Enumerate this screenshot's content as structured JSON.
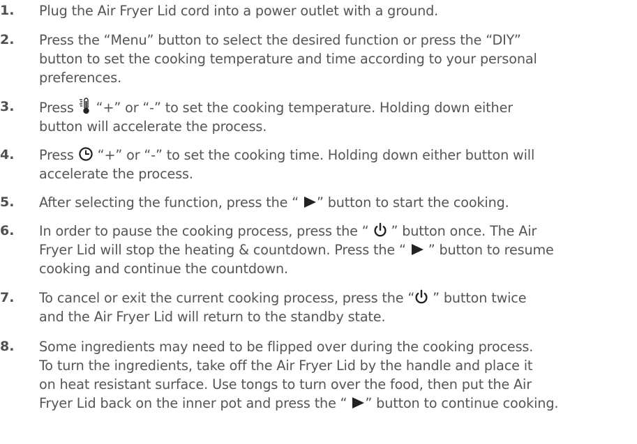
{
  "steps": [
    {
      "number": "1.",
      "lines": [
        "Plug the Air Fryer Lid cord into a power outlet with a ground."
      ]
    },
    {
      "number": "2.",
      "lines": [
        "Press the “Menu” button to select the desired function or press the “DIY”",
        "button to set the cooking temperature and time according to your personal",
        "preferences."
      ]
    },
    {
      "number": "3.",
      "pre": "Press ",
      "icon": "thermometer-icon",
      "post": " “+” or “-” to set the cooking temperature. Holding down either",
      "line2": "button will accelerate the process."
    },
    {
      "number": "4.",
      "pre": "Press ",
      "icon": "clock-icon",
      "post": " “+” or “-” to set the cooking time. Holding down either button will",
      "line2": "accelerate the process."
    },
    {
      "number": "5.",
      "pre": "After selecting the function, press the “ ",
      "icon": "play-icon",
      "post": "” button to start the cooking."
    },
    {
      "number": "6.",
      "l1_pre": "In order to pause the cooking process, press the  “ ",
      "l1_icon": "power-icon",
      "l1_post": " ” button once. The Air",
      "l2_pre": "Fryer Lid will stop the heating & countdown. Press the “ ",
      "l2_icon": "play-icon",
      "l2_post": " ” button to resume",
      "line3": "cooking and continue the countdown."
    },
    {
      "number": "7.",
      "pre": "To cancel or exit the current cooking process, press the “",
      "icon": "power-icon",
      "post": " ” button twice",
      "line2": "and the Air Fryer Lid will return to the standby state."
    },
    {
      "number": "8.",
      "lines": [
        "Some ingredients may need to be flipped over during the cooking process.",
        "To turn the ingredients, take off the Air Fryer Lid by the handle and place it",
        "on heat resistant surface. Use tongs to turn over the food, then put the Air"
      ],
      "last_pre": "Fryer Lid back on the inner pot and press the “ ",
      "last_icon": "play-icon",
      "last_post": "” button to continue cooking."
    }
  ],
  "colors": {
    "text": "#555555",
    "number": "#505050",
    "icon": "#222222"
  }
}
